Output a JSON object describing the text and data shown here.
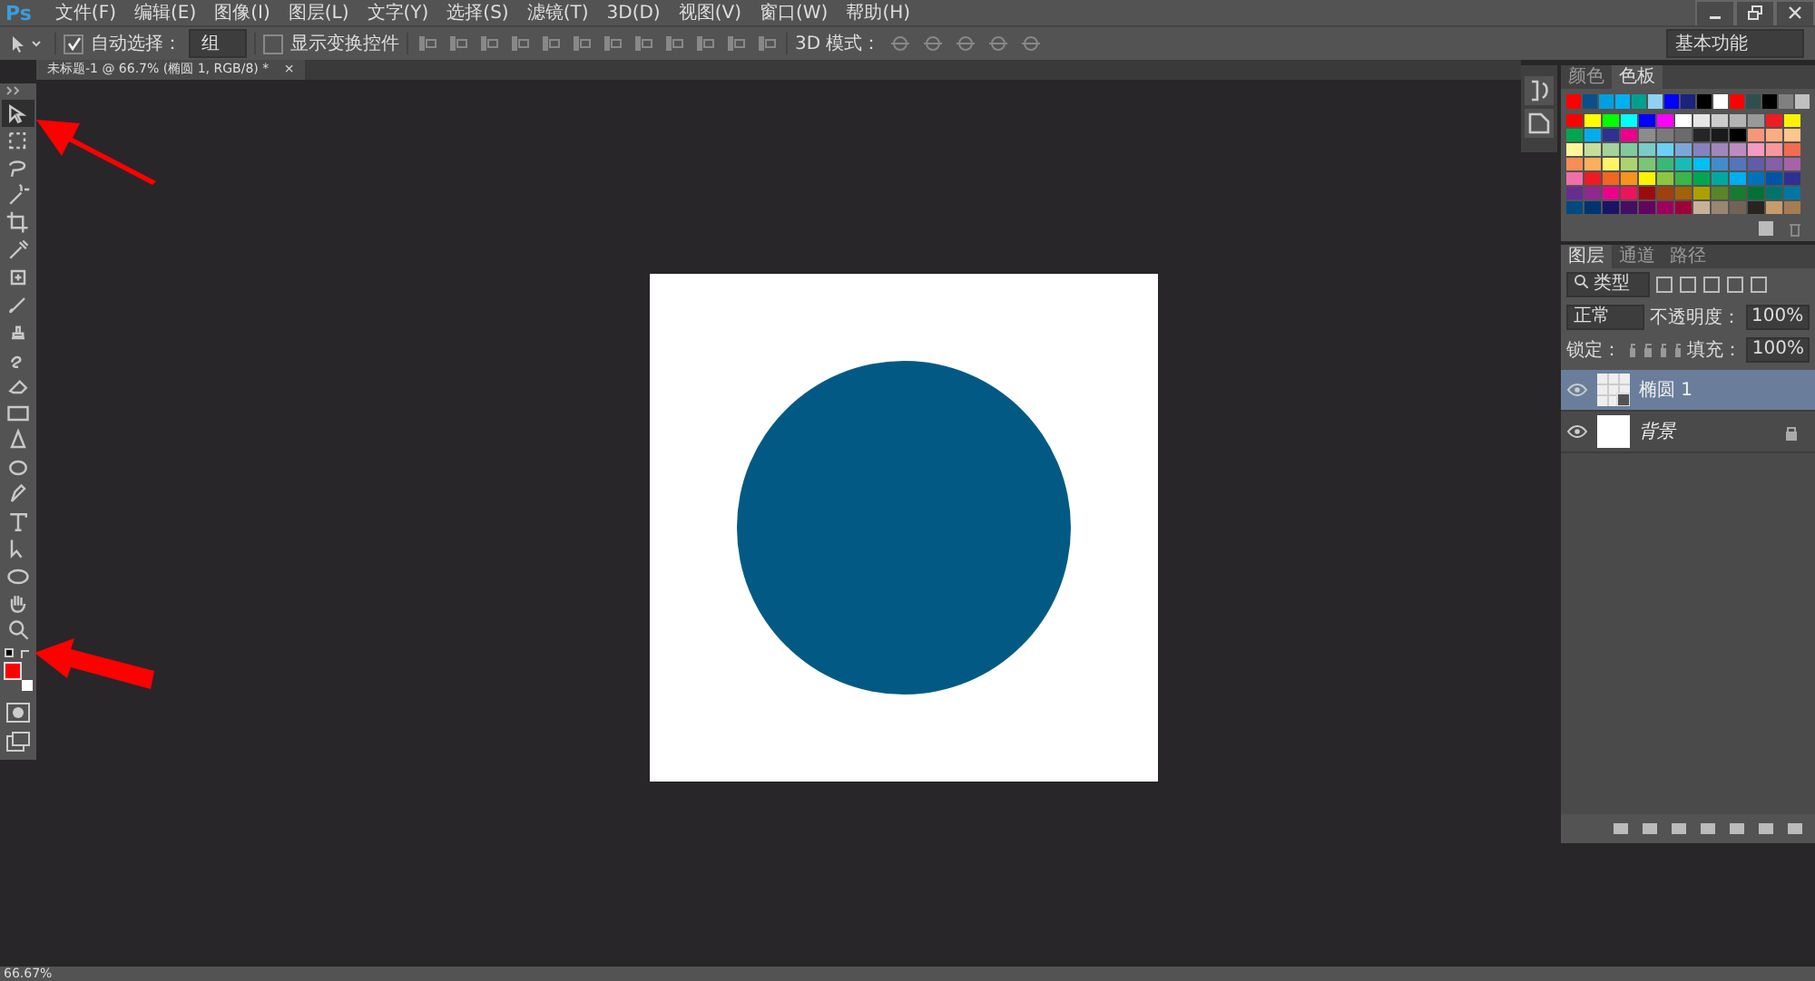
{
  "app_logo": "Ps",
  "menu": [
    "文件(F)",
    "编辑(E)",
    "图像(I)",
    "图层(L)",
    "文字(Y)",
    "选择(S)",
    "滤镜(T)",
    "3D(D)",
    "视图(V)",
    "窗口(W)",
    "帮助(H)"
  ],
  "options_bar": {
    "auto_select": {
      "label": "自动选择：",
      "checked": true
    },
    "auto_select_target": "组",
    "show_transform": {
      "label": "显示变换控件",
      "checked": false
    },
    "mode_3d_label": "3D 模式：",
    "workspace": "基本功能"
  },
  "document_tab": {
    "title": "未标题-1 @ 66.7% (椭圆 1, RGB/8) *",
    "close": "×"
  },
  "tools": [
    {
      "kind": "move",
      "selected": true
    },
    {
      "kind": "marquee",
      "selected": false
    },
    {
      "kind": "lasso",
      "selected": false
    },
    {
      "kind": "wand",
      "selected": false
    },
    {
      "kind": "crop",
      "selected": false
    },
    {
      "kind": "eyedropper",
      "selected": false
    },
    {
      "kind": "healing",
      "selected": false
    },
    {
      "kind": "brush",
      "selected": false
    },
    {
      "kind": "stamp",
      "selected": false
    },
    {
      "kind": "history",
      "selected": false
    },
    {
      "kind": "eraser",
      "selected": false
    },
    {
      "kind": "gradient",
      "selected": false
    },
    {
      "kind": "blur",
      "selected": false
    },
    {
      "kind": "dodge",
      "selected": false
    },
    {
      "kind": "pen",
      "selected": false
    },
    {
      "kind": "type",
      "selected": false
    },
    {
      "kind": "path",
      "selected": false
    },
    {
      "kind": "ellipse",
      "selected": false
    },
    {
      "kind": "hand",
      "selected": false
    },
    {
      "kind": "zoom",
      "selected": false
    }
  ],
  "color_chips": [
    {
      "kind": "foreground",
      "color": "#ff0000"
    },
    {
      "kind": "background",
      "color": "#ffffff"
    }
  ],
  "canvas": {
    "shapes": [
      {
        "kind": "ellipse",
        "color": "#025a84"
      }
    ]
  },
  "swatches_panel": {
    "tabs": [
      {
        "label": "颜色",
        "selected": false
      },
      {
        "label": "色板",
        "selected": true
      }
    ],
    "recent": [
      {
        "color": "#ff0000"
      },
      {
        "color": "#0b4f8a"
      },
      {
        "color": "#00a0e0"
      },
      {
        "color": "#00b0f0"
      },
      {
        "color": "#00a090"
      },
      {
        "color": "#90d0f0"
      },
      {
        "color": "#0000ff"
      },
      {
        "color": "#1a237e"
      },
      {
        "color": "#000000"
      },
      {
        "color": "#ffffff"
      },
      {
        "color": "#ff0000"
      },
      {
        "color": "#2f4f4f"
      },
      {
        "color": "#000000"
      },
      {
        "color": "#808080"
      },
      {
        "color": "#c0c0c0"
      }
    ],
    "rows": [
      [
        {
          "color": "#ff0000"
        },
        {
          "color": "#ffff00"
        },
        {
          "color": "#00ff00"
        },
        {
          "color": "#00ffff"
        },
        {
          "color": "#0000ff"
        },
        {
          "color": "#ff00ff"
        },
        {
          "color": "#ffffff"
        },
        {
          "color": "#e6e6e6"
        },
        {
          "color": "#cccccc"
        },
        {
          "color": "#b3b3b3"
        },
        {
          "color": "#999999"
        },
        {
          "color": "#ee1c24"
        },
        {
          "color": "#fff200"
        }
      ],
      [
        {
          "color": "#00a651"
        },
        {
          "color": "#00aeef"
        },
        {
          "color": "#2e3192"
        },
        {
          "color": "#ec008c"
        },
        {
          "color": "#8c8c8c"
        },
        {
          "color": "#7a7a7a"
        },
        {
          "color": "#6b6b6b"
        },
        {
          "color": "#262626"
        },
        {
          "color": "#1a1a1a"
        },
        {
          "color": "#000000"
        },
        {
          "color": "#f7977a"
        },
        {
          "color": "#fbad82"
        },
        {
          "color": "#fdc68c"
        }
      ],
      [
        {
          "color": "#fff799"
        },
        {
          "color": "#c4df9b"
        },
        {
          "color": "#a3d39c"
        },
        {
          "color": "#82ca9c"
        },
        {
          "color": "#7accc8"
        },
        {
          "color": "#6dcff6"
        },
        {
          "color": "#7da7d9"
        },
        {
          "color": "#8781bd"
        },
        {
          "color": "#a186be"
        },
        {
          "color": "#bd8cbf"
        },
        {
          "color": "#f49ac1"
        },
        {
          "color": "#f6989d"
        },
        {
          "color": "#f26c4f"
        }
      ],
      [
        {
          "color": "#f68e55"
        },
        {
          "color": "#fbaf5c"
        },
        {
          "color": "#fff467"
        },
        {
          "color": "#acd372"
        },
        {
          "color": "#7cc576"
        },
        {
          "color": "#3bb878"
        },
        {
          "color": "#1abbb4"
        },
        {
          "color": "#00bff3"
        },
        {
          "color": "#438ccb"
        },
        {
          "color": "#5574b9"
        },
        {
          "color": "#605ca8"
        },
        {
          "color": "#855fa8"
        },
        {
          "color": "#a763a8"
        }
      ],
      [
        {
          "color": "#f06eaa"
        },
        {
          "color": "#ed1c24"
        },
        {
          "color": "#f26522"
        },
        {
          "color": "#f7941d"
        },
        {
          "color": "#fff200"
        },
        {
          "color": "#8dc63f"
        },
        {
          "color": "#39b54a"
        },
        {
          "color": "#00a651"
        },
        {
          "color": "#00a99d"
        },
        {
          "color": "#00aeef"
        },
        {
          "color": "#0072bc"
        },
        {
          "color": "#0054a6"
        },
        {
          "color": "#2e3192"
        }
      ],
      [
        {
          "color": "#662d91"
        },
        {
          "color": "#92278f"
        },
        {
          "color": "#ec008c"
        },
        {
          "color": "#ed145b"
        },
        {
          "color": "#9e0b0f"
        },
        {
          "color": "#a0410d"
        },
        {
          "color": "#a36209"
        },
        {
          "color": "#aba000"
        },
        {
          "color": "#598527"
        },
        {
          "color": "#197b30"
        },
        {
          "color": "#007236"
        },
        {
          "color": "#00746b"
        },
        {
          "color": "#0076a3"
        }
      ],
      [
        {
          "color": "#004a80"
        },
        {
          "color": "#003471"
        },
        {
          "color": "#1b1464"
        },
        {
          "color": "#440e62"
        },
        {
          "color": "#630460"
        },
        {
          "color": "#9e005d"
        },
        {
          "color": "#9e0039"
        },
        {
          "color": "#c7b299"
        },
        {
          "color": "#998675"
        },
        {
          "color": "#736357"
        },
        {
          "color": "#2a2420"
        },
        {
          "color": "#c69c6d"
        },
        {
          "color": "#a67c52"
        }
      ]
    ]
  },
  "layers_panel": {
    "tabs": [
      {
        "label": "图层",
        "selected": true
      },
      {
        "label": "通道",
        "selected": false
      },
      {
        "label": "路径",
        "selected": false
      }
    ],
    "filter": "类型",
    "blend_mode": "正常",
    "opacity_label": "不透明度：",
    "opacity": "100%",
    "lock_label": "锁定：",
    "fill_label": "填充：",
    "fill": "100%",
    "layers": [
      {
        "name": "椭圆 1",
        "kind": "shape",
        "selected": true,
        "visible": true,
        "locked": false
      },
      {
        "name": "背景",
        "kind": "background",
        "selected": false,
        "visible": true,
        "locked": true
      }
    ]
  },
  "status_bar": {
    "zoom": "66.67%"
  }
}
